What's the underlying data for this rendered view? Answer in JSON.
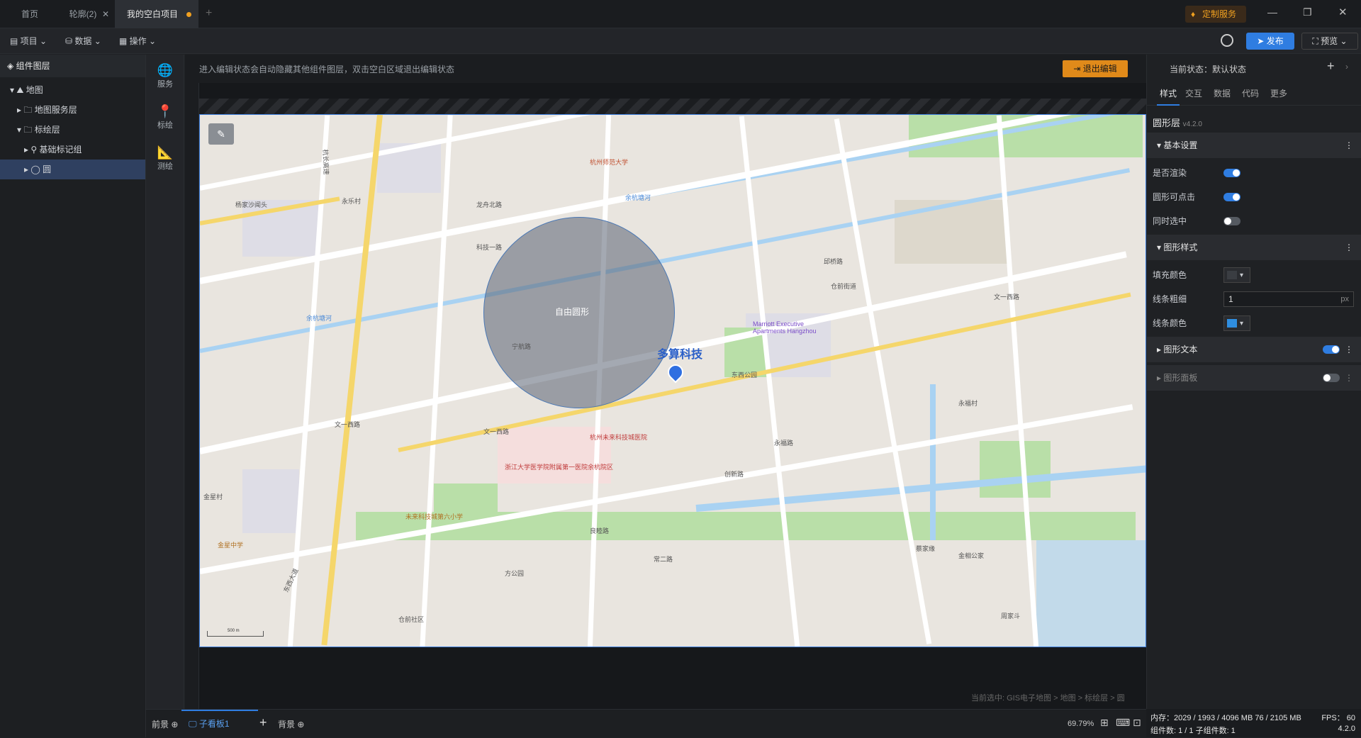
{
  "tabs": [
    {
      "label": "首页",
      "active": false,
      "closable": false
    },
    {
      "label": "轮廓(2)",
      "active": false,
      "closable": true
    },
    {
      "label": "我的空白项目",
      "active": true,
      "closable": false,
      "modified": true
    }
  ],
  "window": {
    "service_label": "定制服务"
  },
  "toolbar": {
    "menus": [
      "项目",
      "数据",
      "操作"
    ],
    "publish_label": "发布",
    "preview_label": "预览"
  },
  "left_panel": {
    "title": "组件图层",
    "tree": [
      {
        "label": "地图",
        "level": 0,
        "icon": "map-icon",
        "expanded": true
      },
      {
        "label": "地图服务层",
        "level": 1,
        "icon": "folder-icon",
        "expanded": false
      },
      {
        "label": "标绘层",
        "level": 1,
        "icon": "folder-icon",
        "expanded": true
      },
      {
        "label": "基础标记组",
        "level": 2,
        "icon": "marker-group-icon",
        "expanded": false
      },
      {
        "label": "圆",
        "level": 2,
        "icon": "circle-icon",
        "expanded": false,
        "selected": true
      }
    ]
  },
  "side_icons": [
    {
      "label": "服务",
      "icon": "globe-icon"
    },
    {
      "label": "标绘",
      "icon": "pin-icon"
    },
    {
      "label": "测绘",
      "icon": "ruler-icon"
    }
  ],
  "canvas": {
    "hint": "进入编辑状态会自动隐藏其他组件图层，双击空白区域退出编辑状态",
    "exit_edit_label": "退出编辑",
    "breadcrumb": "当前选中: GIS电子地图 > 地图 > 标绘层 > 圆",
    "scale_label": "500 m"
  },
  "map_labels": {
    "poi_main": "多算科技",
    "circle_label": "自由圆形",
    "marriott": "Marriott Executive Apartments Hangzhou",
    "roads": [
      "文一西路",
      "文一西路",
      "科技一路",
      "永福路",
      "创新路",
      "良睦路",
      "余杭塘河",
      "杭长高速",
      "东西大道",
      "宁航路",
      "邱桥路",
      "常二路"
    ],
    "places": [
      "杨家沙闻头",
      "永乐村",
      "龙舟北路",
      "金星村",
      "仓前街道",
      "永福村",
      "杭州未来科技城医院",
      "浙江大学医学院附属第一医院余杭院区",
      "未来科技城第六小学",
      "蔡家缘",
      "周家斗",
      "金相公家",
      "仓前社区",
      "文一西路",
      "金星中学",
      "方公园",
      "杭州师范大学",
      "余杭塘河",
      "东西公园"
    ]
  },
  "bottom": {
    "tabs": [
      "前景",
      "子看板1",
      "背景"
    ],
    "zoom": "69.79%"
  },
  "right_panel": {
    "state_label": "当前状态：默认状态",
    "tabs": [
      "样式",
      "交互",
      "数据",
      "代码",
      "更多"
    ],
    "active_tab": "样式",
    "component_name": "圆形层",
    "component_version": "v4.2.0",
    "sections": {
      "basic": {
        "title": "基本设置",
        "rows": [
          {
            "label": "是否渲染",
            "on": true
          },
          {
            "label": "圆形可点击",
            "on": true
          },
          {
            "label": "同时选中",
            "on": false
          }
        ]
      },
      "style": {
        "title": "图形样式",
        "fill_label": "填充颜色",
        "fill_color": "#3a3d42",
        "width_label": "线条粗细",
        "width_value": "1",
        "width_unit": "px",
        "line_label": "线条颜色",
        "line_color": "#2f8ee0"
      },
      "text": {
        "title": "图形文本",
        "on": true
      },
      "panel": {
        "title": "图形面板",
        "on": false
      }
    }
  },
  "status": {
    "memory": "内存：2029 / 1993 / 4096 MB  76 / 2105 MB",
    "fps": "FPS： 60",
    "counts": "组件数: 1 / 1   子组件数: 1",
    "version": "4.2.0"
  },
  "colors": {
    "accent": "#2f7de1",
    "selected_row": "#2f4060",
    "exit_button": "#e08a1a",
    "circle_fill": "#6b7282"
  }
}
